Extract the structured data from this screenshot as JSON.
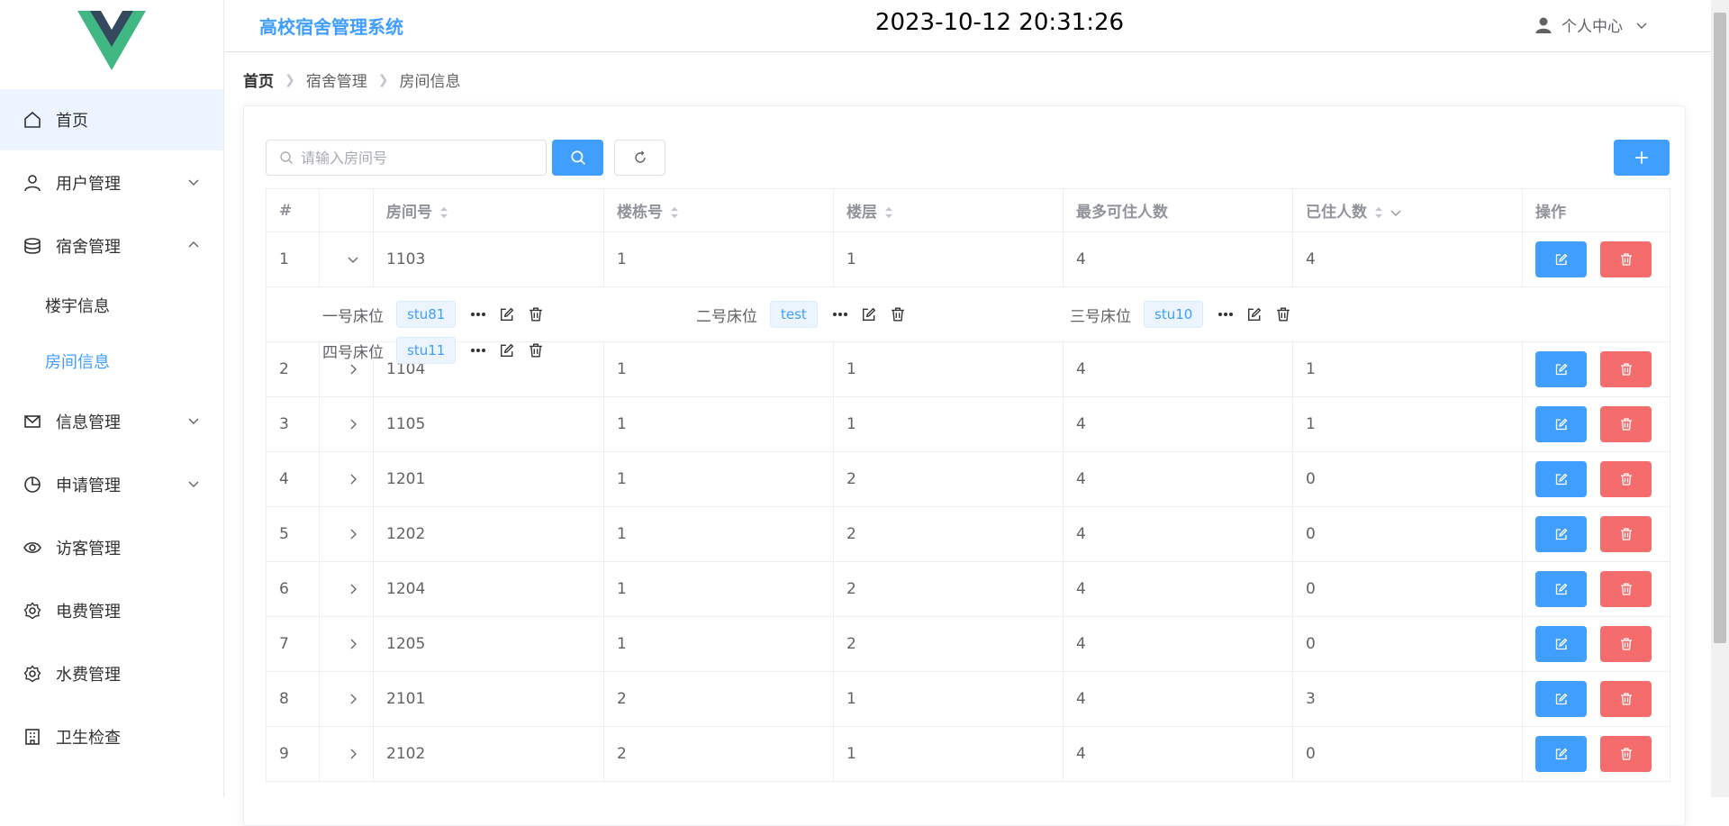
{
  "sidebar": {
    "menu": [
      {
        "label": "首页",
        "icon": "home-icon"
      },
      {
        "label": "用户管理",
        "icon": "user-icon"
      },
      {
        "label": "宿舍管理",
        "icon": "database-icon"
      },
      {
        "label": "信息管理",
        "icon": "message-icon"
      },
      {
        "label": "申请管理",
        "icon": "pie-chart-icon"
      },
      {
        "label": "访客管理",
        "icon": "eye-icon"
      },
      {
        "label": "电费管理",
        "icon": "gear-icon"
      },
      {
        "label": "水费管理",
        "icon": "gear-icon"
      },
      {
        "label": "卫生检查",
        "icon": "building-icon"
      }
    ],
    "submenu": [
      {
        "label": "楼宇信息"
      },
      {
        "label": "房间信息"
      }
    ]
  },
  "header": {
    "title": "高校宿舍管理系统",
    "datetime": "2023-10-12 20:31:26",
    "user_center": "个人中心"
  },
  "breadcrumb": [
    "首页",
    "宿舍管理",
    "房间信息"
  ],
  "search": {
    "placeholder": "请输入房间号",
    "value": ""
  },
  "table": {
    "headers": [
      "#",
      "",
      "房间号",
      "楼栋号",
      "楼层",
      "最多可住人数",
      "已住人数",
      "操作"
    ],
    "rows": [
      {
        "index": "1",
        "room": "1103",
        "building": "1",
        "floor": "1",
        "max": "4",
        "current": "4"
      },
      {
        "index": "2",
        "room": "1104",
        "building": "1",
        "floor": "1",
        "max": "4",
        "current": "1"
      },
      {
        "index": "3",
        "room": "1105",
        "building": "1",
        "floor": "1",
        "max": "4",
        "current": "1"
      },
      {
        "index": "4",
        "room": "1201",
        "building": "1",
        "floor": "2",
        "max": "4",
        "current": "0"
      },
      {
        "index": "5",
        "room": "1202",
        "building": "1",
        "floor": "2",
        "max": "4",
        "current": "0"
      },
      {
        "index": "6",
        "room": "1204",
        "building": "1",
        "floor": "2",
        "max": "4",
        "current": "0"
      },
      {
        "index": "7",
        "room": "1205",
        "building": "1",
        "floor": "2",
        "max": "4",
        "current": "0"
      },
      {
        "index": "8",
        "room": "2101",
        "building": "2",
        "floor": "1",
        "max": "4",
        "current": "3"
      },
      {
        "index": "9",
        "room": "2102",
        "building": "2",
        "floor": "1",
        "max": "4",
        "current": "0"
      }
    ],
    "expanded_beds": [
      {
        "label": "一号床位",
        "student": "stu81"
      },
      {
        "label": "二号床位",
        "student": "test"
      },
      {
        "label": "三号床位",
        "student": "stu10"
      },
      {
        "label": "四号床位",
        "student": "stu11"
      }
    ]
  },
  "colors": {
    "primary": "#409eff",
    "danger": "#f56c6c",
    "logo_green": "#41b883",
    "logo_dark": "#35495e"
  }
}
